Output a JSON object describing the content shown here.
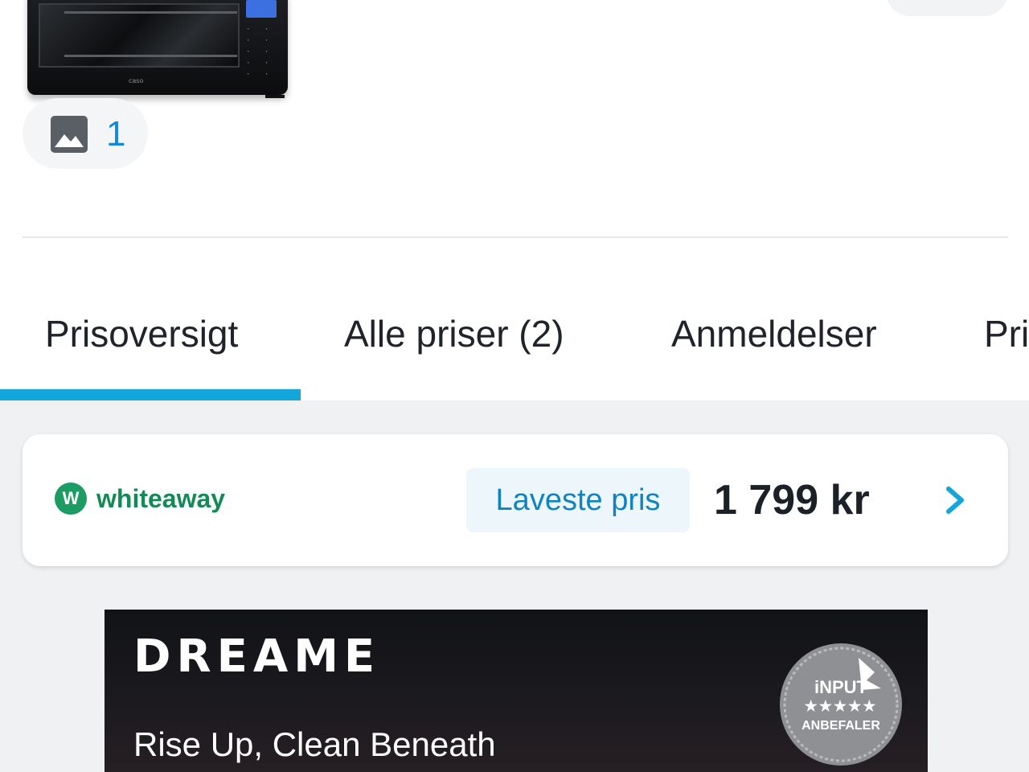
{
  "product": {
    "image_alt": "oven",
    "brand_mark": "caso",
    "image_count": "1"
  },
  "tabs": [
    {
      "label": "Prisoversigt",
      "active": true
    },
    {
      "label": "Alle priser (2)",
      "active": false
    },
    {
      "label": "Anmeldelser",
      "active": false
    },
    {
      "label": "Pri",
      "active": false
    }
  ],
  "price_card": {
    "shop_name": "whiteaway",
    "shop_logo_letter": "W",
    "badge_label": "Laveste pris",
    "price": "1 799 kr",
    "chevron_icon": "chevron-right-icon"
  },
  "ad": {
    "brand": "DREAME",
    "tagline": "Rise Up, Clean Beneath",
    "award": {
      "line1": "iNPUT",
      "stars": "★★★★★",
      "line2": "ANBEFALER"
    }
  },
  "colors": {
    "accent": "#12a6da",
    "link_blue": "#1488d8",
    "shop_green": "#1b9c63",
    "background_grey": "#eff1f2"
  }
}
